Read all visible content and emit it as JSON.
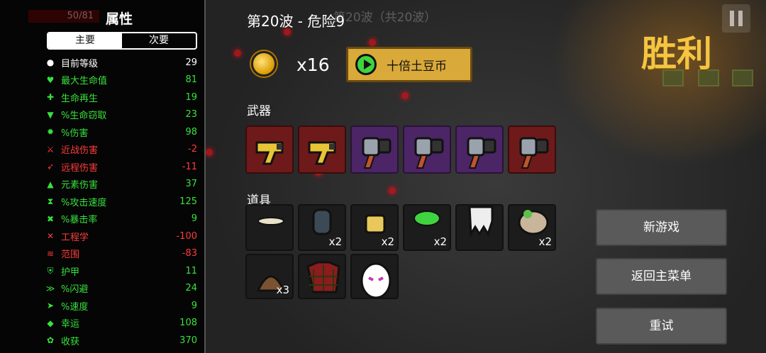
{
  "stats_panel": {
    "hp_text": "50/81",
    "title": "属性",
    "tabs": [
      {
        "label": "主要",
        "active": true
      },
      {
        "label": "次要",
        "active": false
      }
    ],
    "rows": [
      {
        "icon": "level-icon",
        "glyph": "●",
        "label": "目前等级",
        "value": "29",
        "color": "w"
      },
      {
        "icon": "heart-icon",
        "glyph": "♥",
        "label": "最大生命值",
        "value": "81",
        "color": "g"
      },
      {
        "icon": "regen-icon",
        "glyph": "✚",
        "label": "生命再生",
        "value": "19",
        "color": "g"
      },
      {
        "icon": "lifesteal-icon",
        "glyph": "▼",
        "label": "%生命窃取",
        "value": "23",
        "color": "g"
      },
      {
        "icon": "damage-icon",
        "glyph": "✹",
        "label": "%伤害",
        "value": "98",
        "color": "g"
      },
      {
        "icon": "melee-icon",
        "glyph": "⚔",
        "label": "近战伤害",
        "value": "-2",
        "color": "r"
      },
      {
        "icon": "ranged-icon",
        "glyph": "➶",
        "label": "远程伤害",
        "value": "-11",
        "color": "r"
      },
      {
        "icon": "elemental-icon",
        "glyph": "▲",
        "label": "元素伤害",
        "value": "37",
        "color": "g"
      },
      {
        "icon": "attack-speed-icon",
        "glyph": "⧗",
        "label": "%攻击速度",
        "value": "125",
        "color": "g"
      },
      {
        "icon": "crit-icon",
        "glyph": "✖",
        "label": "%暴击率",
        "value": "9",
        "color": "g"
      },
      {
        "icon": "engineering-icon",
        "glyph": "✕",
        "label": "工程学",
        "value": "-100",
        "color": "r"
      },
      {
        "icon": "range-icon",
        "glyph": "≋",
        "label": "范围",
        "value": "-83",
        "color": "r"
      },
      {
        "icon": "armor-icon",
        "glyph": "⛨",
        "label": "护甲",
        "value": "11",
        "color": "g"
      },
      {
        "icon": "dodge-icon",
        "glyph": "≫",
        "label": "%闪避",
        "value": "24",
        "color": "g"
      },
      {
        "icon": "speed-icon",
        "glyph": "➤",
        "label": "%速度",
        "value": "9",
        "color": "g"
      },
      {
        "icon": "luck-icon",
        "glyph": "◆",
        "label": "幸运",
        "value": "108",
        "color": "g"
      },
      {
        "icon": "harvest-icon",
        "glyph": "✿",
        "label": "收获",
        "value": "370",
        "color": "g"
      }
    ]
  },
  "header": {
    "wave_title": "第20波 - 危险9",
    "wave_background": "第20波（共20波）"
  },
  "reward": {
    "coin_count": "x16",
    "tenx_button": "十倍土豆币"
  },
  "weapons": {
    "label": "武器",
    "slots": [
      {
        "name": "taser-weapon",
        "tier": "red"
      },
      {
        "name": "taser-weapon",
        "tier": "red"
      },
      {
        "name": "wrench-gun-weapon",
        "tier": "purple"
      },
      {
        "name": "wrench-gun-weapon",
        "tier": "purple"
      },
      {
        "name": "wrench-gun-weapon",
        "tier": "purple"
      },
      {
        "name": "wrench-gun-weapon",
        "tier": "red"
      }
    ]
  },
  "items": {
    "label": "道具",
    "slots": [
      {
        "name": "lizard-item",
        "qty": ""
      },
      {
        "name": "canister-item",
        "qty": "x2"
      },
      {
        "name": "bucket-item",
        "qty": "x2"
      },
      {
        "name": "slime-item",
        "qty": "x2"
      },
      {
        "name": "skull-item",
        "qty": ""
      },
      {
        "name": "sack-item",
        "qty": "x2"
      },
      {
        "name": "poop-item",
        "qty": "x3"
      },
      {
        "name": "plaid-shirt-item",
        "qty": ""
      },
      {
        "name": "egg-face-item",
        "qty": ""
      }
    ]
  },
  "result": {
    "victory_text": "胜利",
    "buttons": [
      "新游戏",
      "返回主菜单",
      "重试"
    ]
  },
  "colors": {
    "positive": "#37e23c",
    "negative": "#ff3b3b",
    "victory": "#f5c542",
    "tier_red": "#6e1a1a",
    "tier_purple": "#4b2566"
  }
}
